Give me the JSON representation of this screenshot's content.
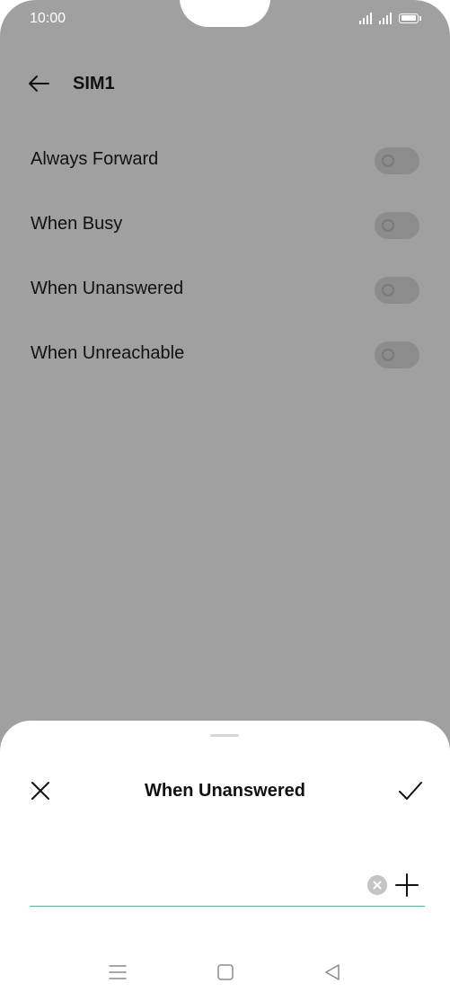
{
  "status_bar": {
    "time": "10:00",
    "icons": [
      "signal-sim1-icon",
      "signal-sim2-icon",
      "battery-icon"
    ]
  },
  "header": {
    "back_icon": "arrow-left-icon",
    "title": "SIM1"
  },
  "forwarding_options": [
    {
      "label": "Always Forward",
      "enabled": false
    },
    {
      "label": "When Busy",
      "enabled": false
    },
    {
      "label": "When Unanswered",
      "enabled": false
    },
    {
      "label": "When Unreachable",
      "enabled": false
    }
  ],
  "sheet": {
    "close_icon": "close-icon",
    "title": "When Unanswered",
    "confirm_icon": "check-icon",
    "number_value": "",
    "clear_icon": "clear-circle-icon",
    "add_icon": "plus-icon"
  },
  "nav_bar": {
    "icons": [
      "menu-icon",
      "home-icon",
      "back-icon"
    ]
  },
  "colors": {
    "overlay": "#a0a0a0",
    "accent": "#2ecc8e",
    "text": "#111111"
  }
}
